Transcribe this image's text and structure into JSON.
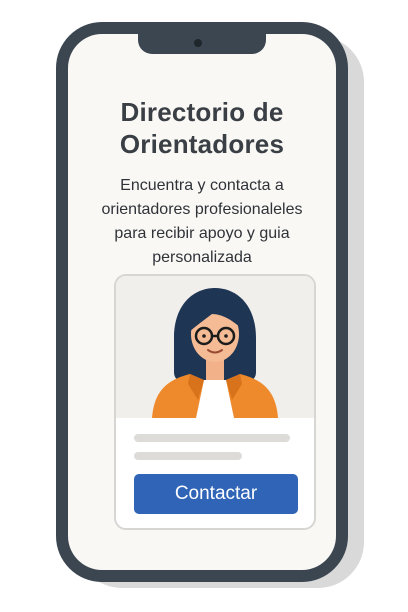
{
  "screen": {
    "title": "Directorio de Orientadores",
    "subtitle": "Encuentra y contacta a orientadores profesionaleles para recibir apoyo y guia personalizada"
  },
  "card": {
    "photo_icon": "person-avatar",
    "button_label": "Contactar"
  },
  "colors": {
    "phone_frame": "#3b4650",
    "screen_bg": "#faf8f5",
    "button_bg": "#2f64b7",
    "jacket": "#ef8a2c",
    "hair": "#1f3554"
  }
}
